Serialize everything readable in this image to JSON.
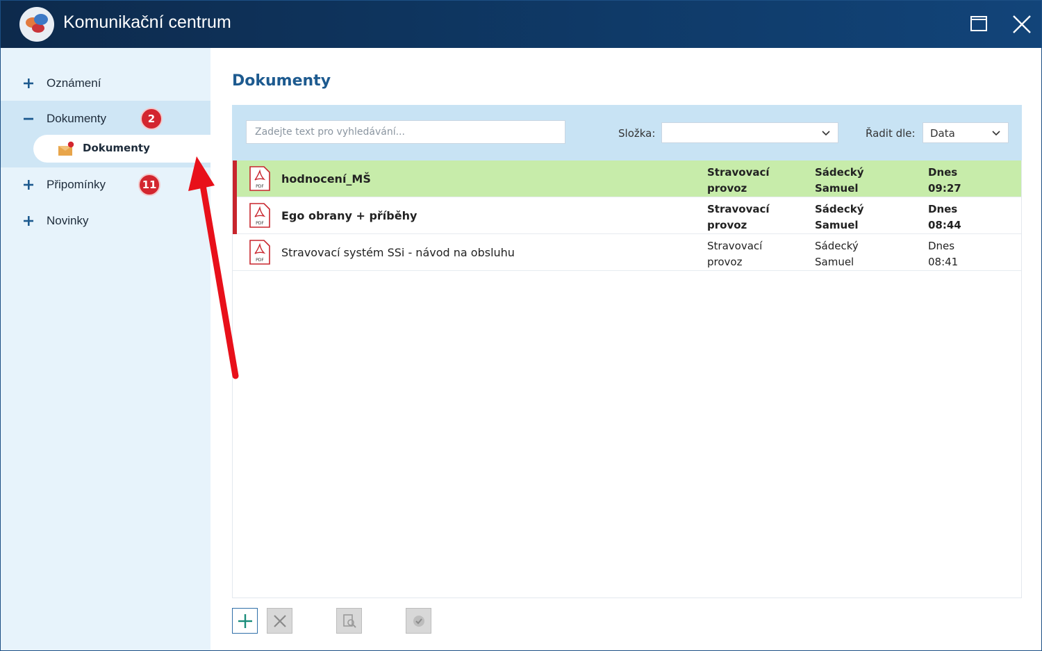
{
  "window": {
    "title": "Komunikační centrum"
  },
  "sidebar": {
    "items": [
      {
        "label": "Oznámení",
        "expanded": false
      },
      {
        "label": "Dokumenty",
        "expanded": true,
        "badge": "2",
        "children": [
          {
            "label": "Dokumenty"
          }
        ]
      },
      {
        "label": "Připomínky",
        "expanded": false,
        "badge": "11"
      },
      {
        "label": "Novinky",
        "expanded": false
      }
    ]
  },
  "main": {
    "title": "Dokumenty",
    "search": {
      "placeholder": "Zadejte text pro vyhledávání...",
      "value": ""
    },
    "folder": {
      "label": "Složka:",
      "value": ""
    },
    "sort": {
      "label": "Řadit dle:",
      "value": "Data"
    },
    "documents": [
      {
        "name": "hodnocení_MŠ",
        "category": [
          "Stravovací",
          "provoz"
        ],
        "author": [
          "Sádecký",
          "Samuel"
        ],
        "date": [
          "Dnes",
          "09:27"
        ],
        "unread": true,
        "selected": true
      },
      {
        "name": "Ego obrany + příběhy",
        "category": [
          "Stravovací",
          "provoz"
        ],
        "author": [
          "Sádecký",
          "Samuel"
        ],
        "date": [
          "Dnes",
          "08:44"
        ],
        "unread": true,
        "selected": false
      },
      {
        "name": "Stravovací systém SSi - návod na obsluhu",
        "category": [
          "Stravovací",
          "provoz"
        ],
        "author": [
          "Sádecký",
          "Samuel"
        ],
        "date": [
          "Dnes",
          "08:41"
        ],
        "unread": false,
        "selected": false
      }
    ],
    "pdf_icon_text": "PDF"
  },
  "colors": {
    "titlebar": "#0f3a68",
    "sidebar_bg": "#e7f3fb",
    "accent": "#1d5a8f",
    "selected_row": "#c7ecaa",
    "unread_marker": "#c8252d",
    "badge": "#d3262f",
    "annotation_arrow": "#e8101a"
  },
  "icons": {
    "expand": "plus-icon",
    "collapse": "minus-icon",
    "document": "pdf-icon",
    "folder": "envelope-icon",
    "toolbar": [
      "add-icon",
      "delete-icon",
      "preview-icon",
      "confirm-icon"
    ]
  }
}
